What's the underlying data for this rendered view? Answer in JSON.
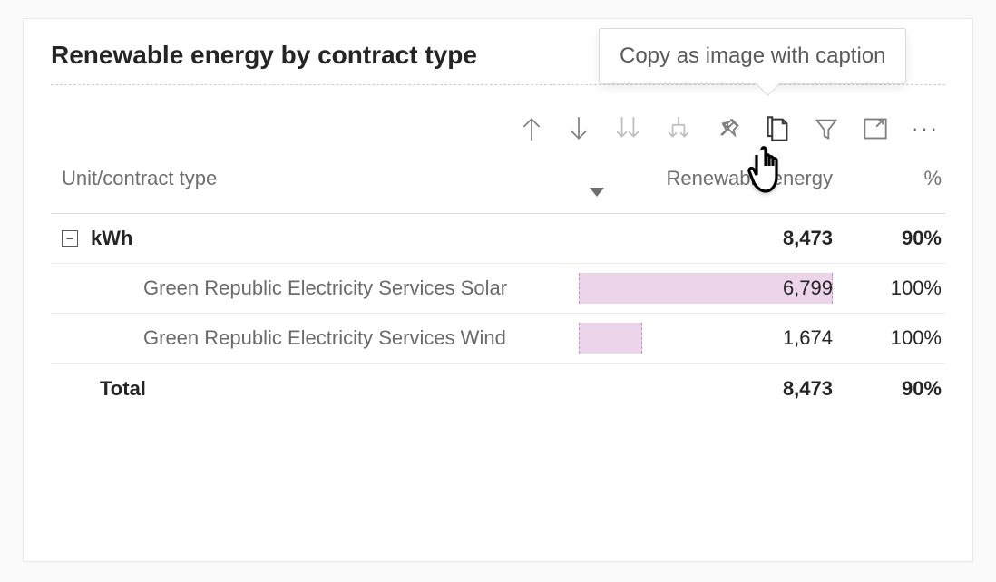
{
  "title": "Renewable energy by contract type",
  "tooltip": "Copy as image with caption",
  "columns": {
    "c0": "Unit/contract type",
    "c1": "Renewable energy",
    "c2": "%"
  },
  "group": {
    "label": "kWh",
    "energy": "8,473",
    "pct": "90%"
  },
  "rows": [
    {
      "label": "Green Republic Electricity Services Solar",
      "energy": "6,799",
      "pct": "100%",
      "bar_pct": 100
    },
    {
      "label": "Green Republic Electricity Services Wind",
      "energy": "1,674",
      "pct": "100%",
      "bar_pct": 25
    }
  ],
  "total": {
    "label": "Total",
    "energy": "8,473",
    "pct": "90%"
  },
  "chart_data": {
    "type": "table",
    "title": "Renewable energy by contract type",
    "columns": [
      "Unit/contract type",
      "Renewable energy",
      "%"
    ],
    "groups": [
      {
        "unit": "kWh",
        "subtotal": {
          "energy": 8473,
          "pct": 90
        },
        "items": [
          {
            "name": "Green Republic Electricity Services Solar",
            "energy": 6799,
            "pct": 100
          },
          {
            "name": "Green Republic Electricity Services Wind",
            "energy": 1674,
            "pct": 100
          }
        ]
      }
    ],
    "total": {
      "energy": 8473,
      "pct": 90
    }
  }
}
